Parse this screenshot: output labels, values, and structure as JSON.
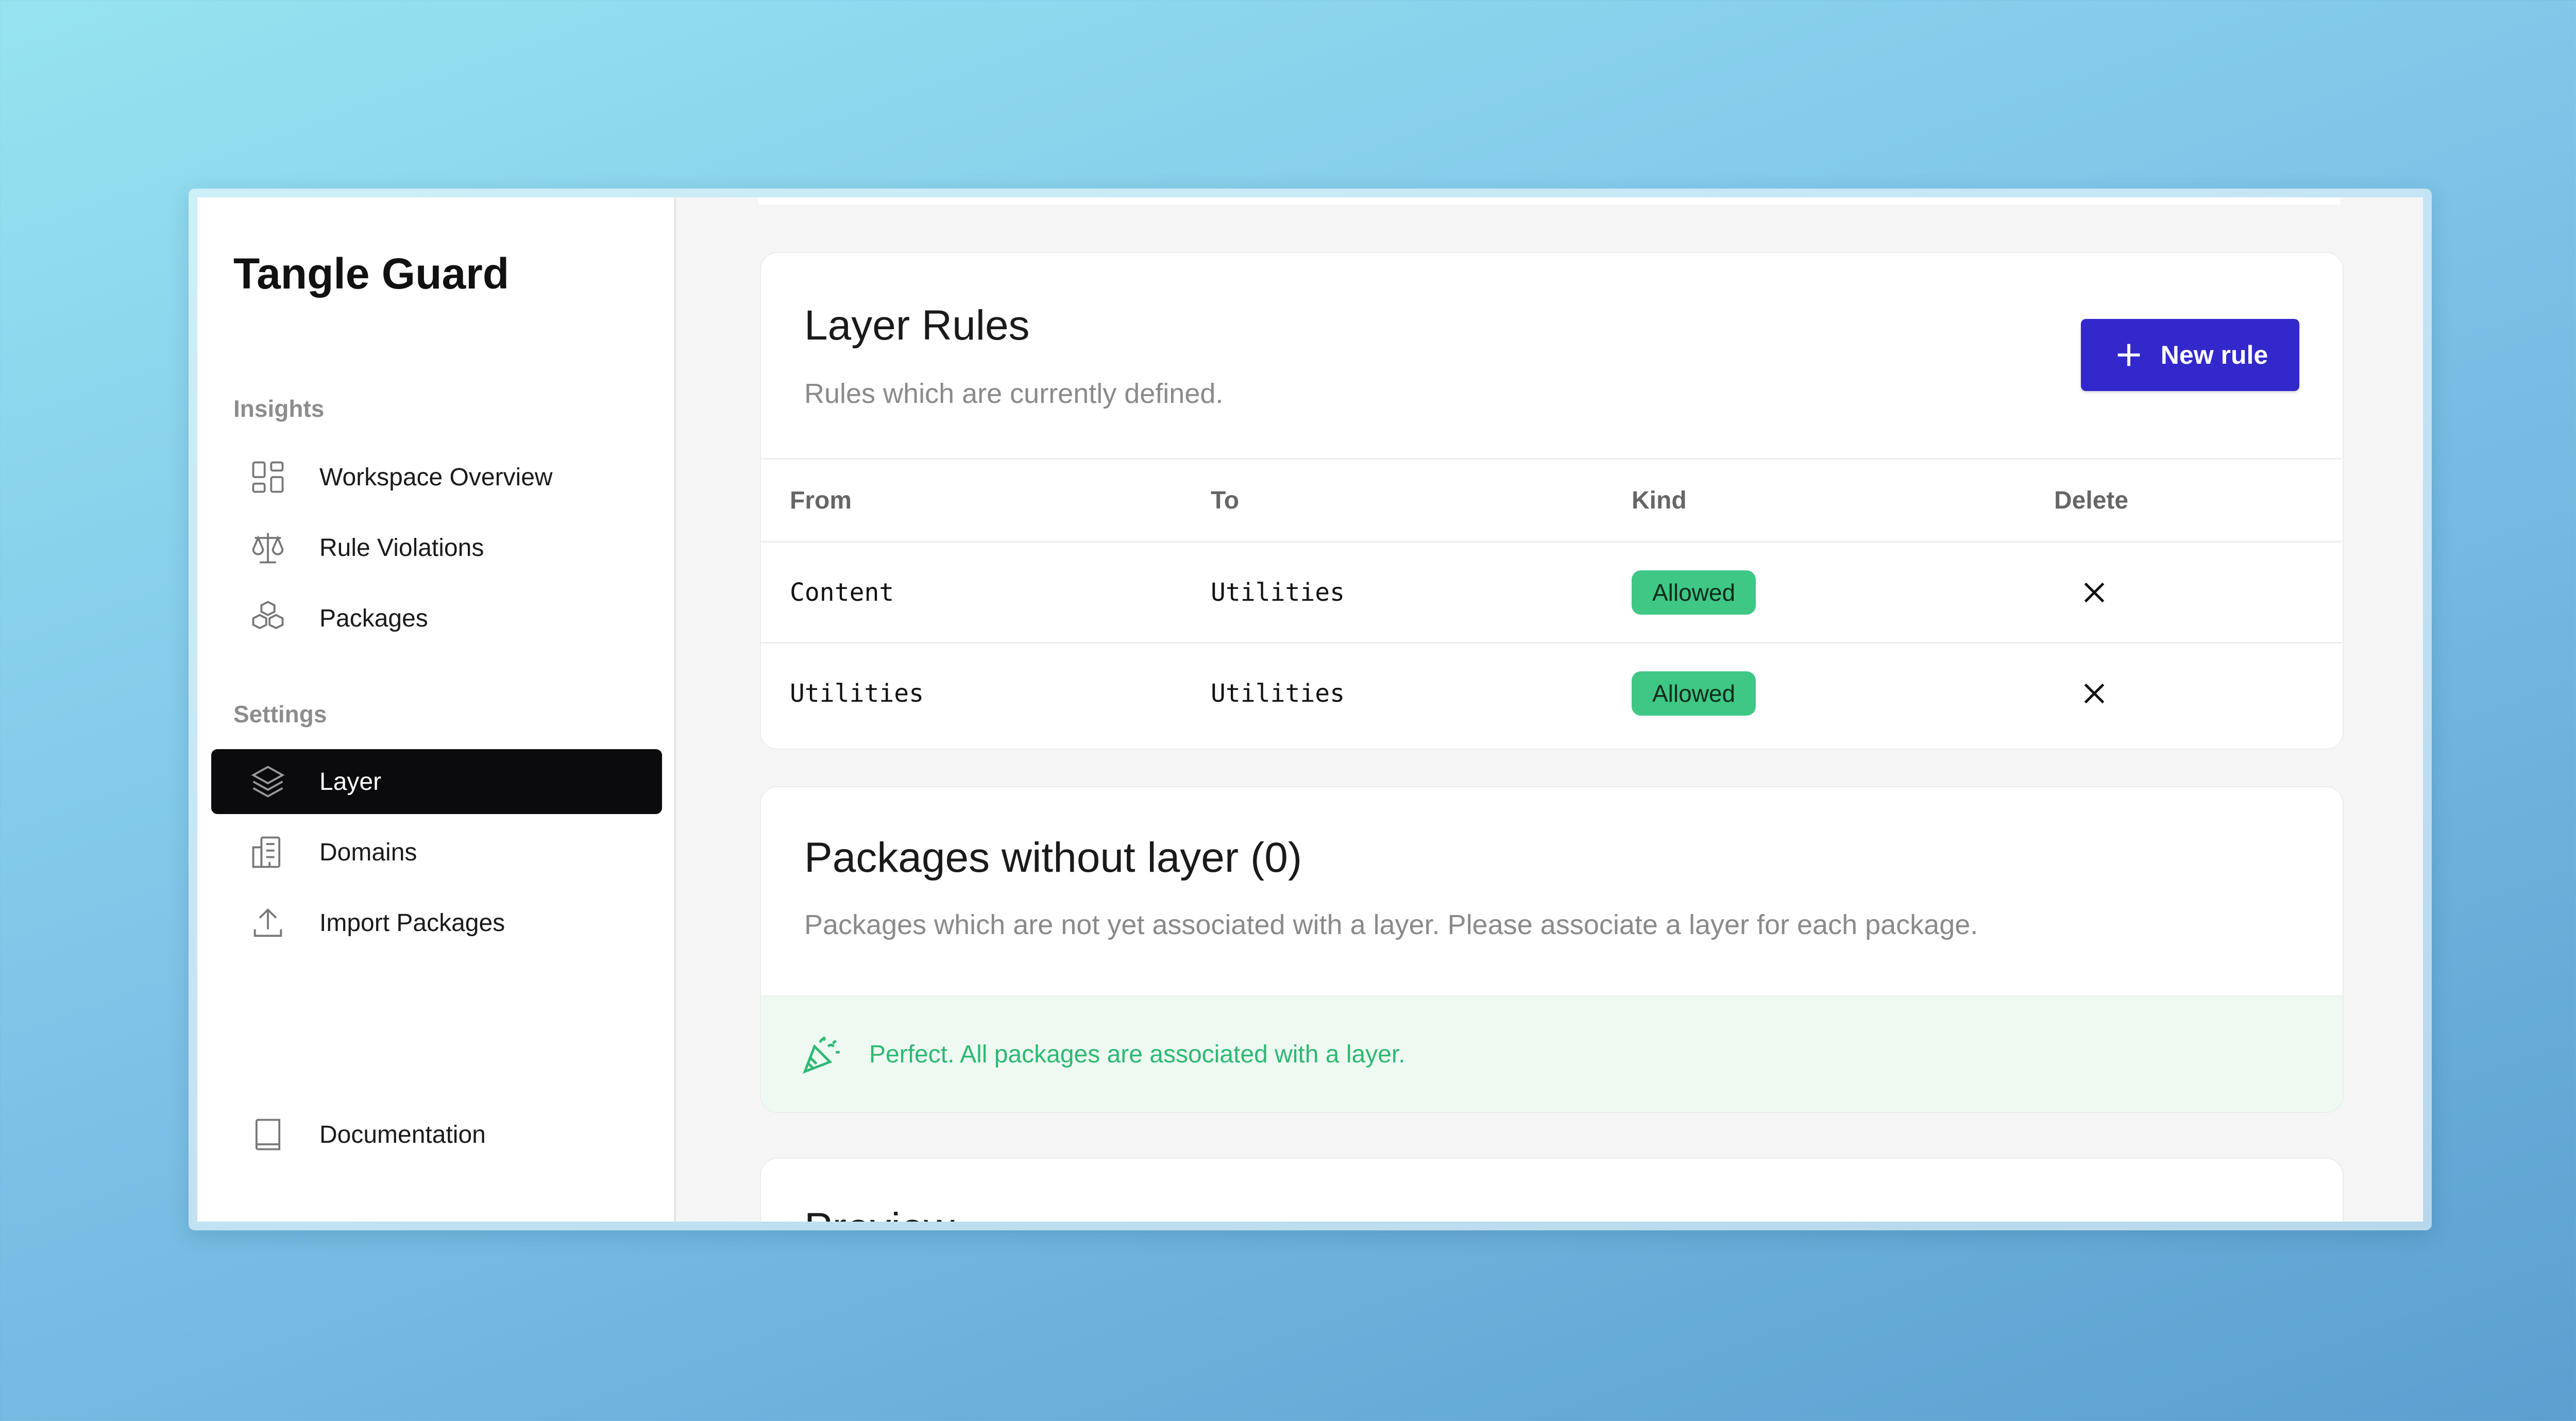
{
  "app": {
    "title": "Tangle Guard"
  },
  "sidebar": {
    "insights_label": "Insights",
    "settings_label": "Settings",
    "insights": [
      {
        "label": "Workspace Overview",
        "icon": "grid-icon"
      },
      {
        "label": "Rule Violations",
        "icon": "scale-icon"
      },
      {
        "label": "Packages",
        "icon": "cubes-icon"
      }
    ],
    "settings": [
      {
        "label": "Layer",
        "icon": "layers-icon",
        "active": true
      },
      {
        "label": "Domains",
        "icon": "buildings-icon"
      },
      {
        "label": "Import Packages",
        "icon": "upload-icon"
      }
    ],
    "footer": {
      "label": "Documentation",
      "icon": "book-icon"
    }
  },
  "layer_rules": {
    "title": "Layer Rules",
    "subtitle": "Rules which are currently defined.",
    "new_rule_label": "New rule",
    "columns": [
      "From",
      "To",
      "Kind",
      "Delete"
    ],
    "rows": [
      {
        "from": "Content",
        "to": "Utilities",
        "kind": "Allowed"
      },
      {
        "from": "Utilities",
        "to": "Utilities",
        "kind": "Allowed"
      }
    ]
  },
  "packages_without_layer": {
    "title": "Packages without layer (0)",
    "subtitle": "Packages which are not yet associated with a layer. Please associate a layer for each package.",
    "success_message": "Perfect. All packages are associated with a layer."
  },
  "preview": {
    "title": "Preview"
  },
  "colors": {
    "accent": "#3328cc",
    "success": "#3fc785",
    "active_nav": "#0b0b0d"
  }
}
